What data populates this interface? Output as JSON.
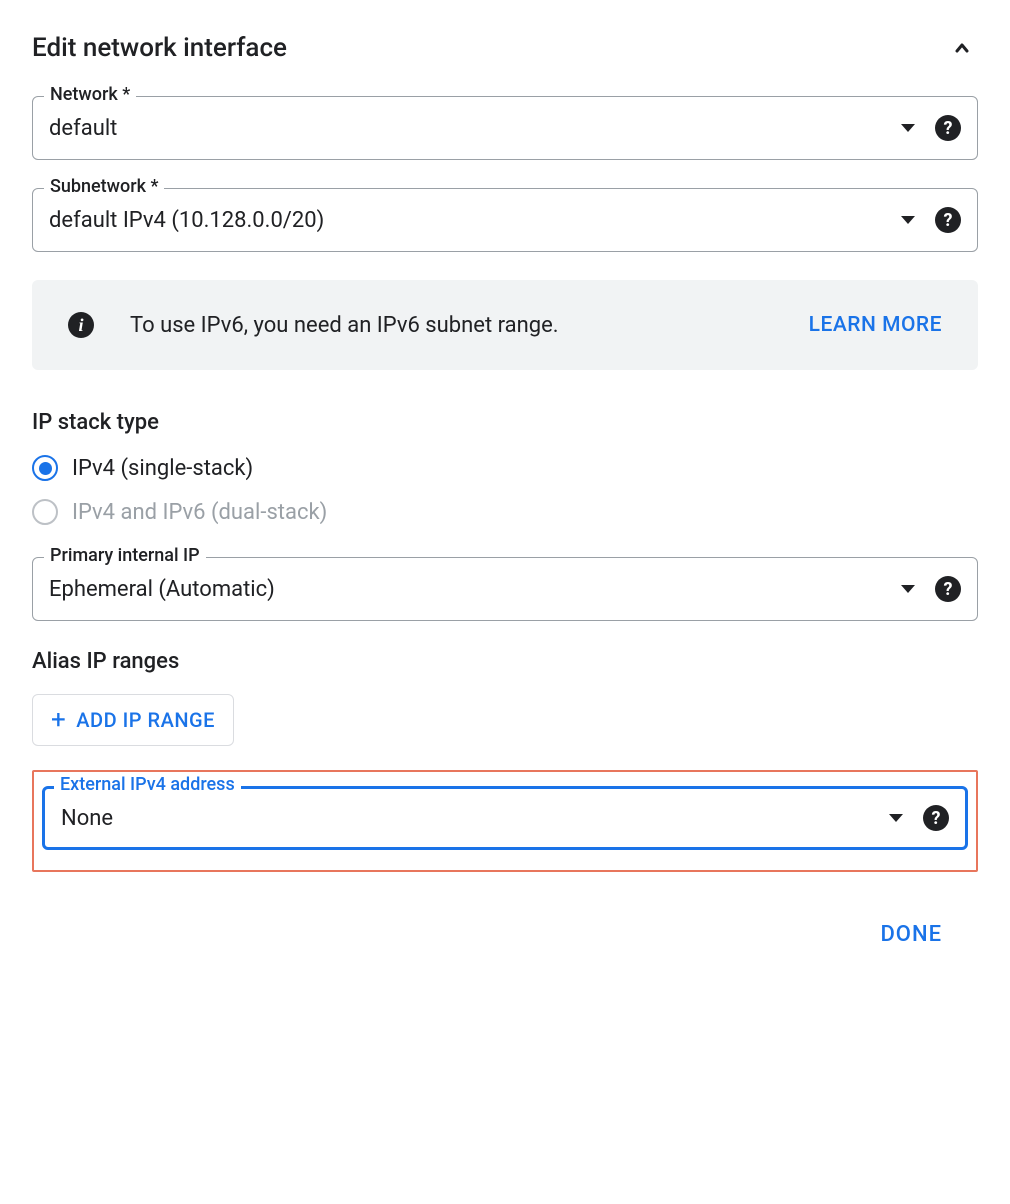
{
  "header": {
    "title": "Edit network interface"
  },
  "fields": {
    "network": {
      "label": "Network *",
      "value": "default"
    },
    "subnetwork": {
      "label": "Subnetwork *",
      "value": "default IPv4 (10.128.0.0/20)"
    },
    "primary_ip": {
      "label": "Primary internal IP",
      "value": "Ephemeral (Automatic)"
    },
    "external_ip": {
      "label": "External IPv4 address",
      "value": "None"
    }
  },
  "info_banner": {
    "text": "To use IPv6, you need an IPv6 subnet range.",
    "learn_more": "LEARN MORE"
  },
  "ip_stack": {
    "title": "IP stack type",
    "option1": "IPv4 (single-stack)",
    "option2": "IPv4 and IPv6 (dual-stack)"
  },
  "alias": {
    "title": "Alias IP ranges",
    "add_button": "ADD IP RANGE"
  },
  "actions": {
    "done": "DONE"
  }
}
